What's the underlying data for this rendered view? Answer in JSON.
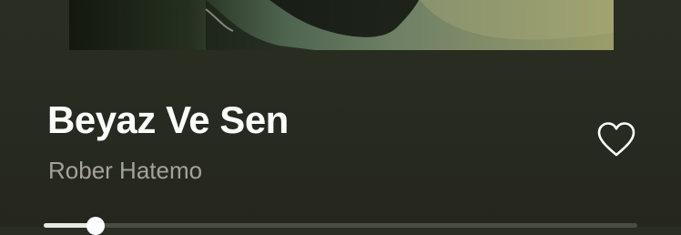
{
  "now_playing": {
    "title": "Beyaz Ve Sen",
    "artist": "Rober Hatemo",
    "liked": false,
    "progress_fraction": 0.087
  },
  "icons": {
    "like": "heart-icon"
  },
  "colors": {
    "background": "#282b21",
    "title": "#ffffff",
    "artist": "#a3a39a",
    "progress_track": "#4b4d44",
    "progress_fill": "#e9e9e4"
  }
}
